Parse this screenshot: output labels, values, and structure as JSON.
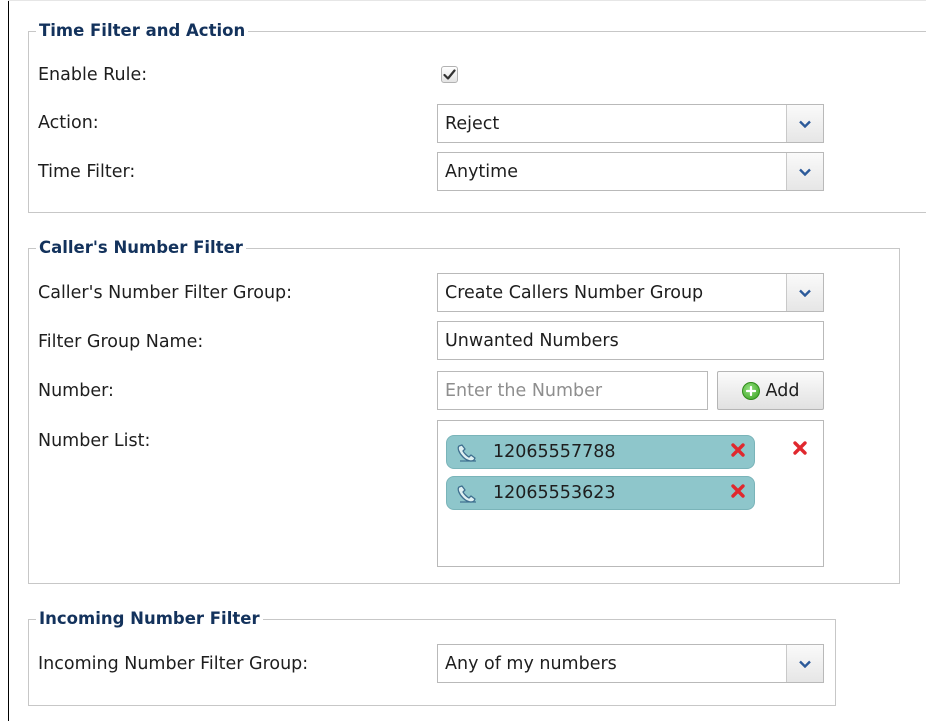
{
  "time_filter": {
    "legend": "Time Filter and Action",
    "enable_rule_label": "Enable Rule:",
    "enable_rule_checked": true,
    "action_label": "Action:",
    "action_value": "Reject",
    "time_filter_label": "Time Filter:",
    "time_filter_value": "Anytime"
  },
  "callers_filter": {
    "legend": "Caller's Number Filter",
    "group_label": "Caller's Number Filter Group:",
    "group_value": "Create Callers Number Group",
    "name_label": "Filter Group Name:",
    "name_value": "Unwanted Numbers",
    "number_label": "Number:",
    "number_placeholder": "Enter the Number",
    "add_label": "Add",
    "list_label": "Number List:",
    "numbers": [
      "12065557788",
      "12065553623"
    ]
  },
  "incoming_filter": {
    "legend": "Incoming Number Filter",
    "group_label": "Incoming Number Filter Group:",
    "group_value": "Any of my numbers"
  },
  "colors": {
    "legend_text": "#13325c",
    "pill_bg": "#8ec6cb",
    "remove_red": "#e0282e",
    "add_green": "#3aa020"
  },
  "icons": {
    "dropdown": "chevron-down-icon",
    "checkbox": "checkmark-icon",
    "add": "plus-circle-icon",
    "phone": "phone-icon",
    "remove": "close-icon"
  }
}
